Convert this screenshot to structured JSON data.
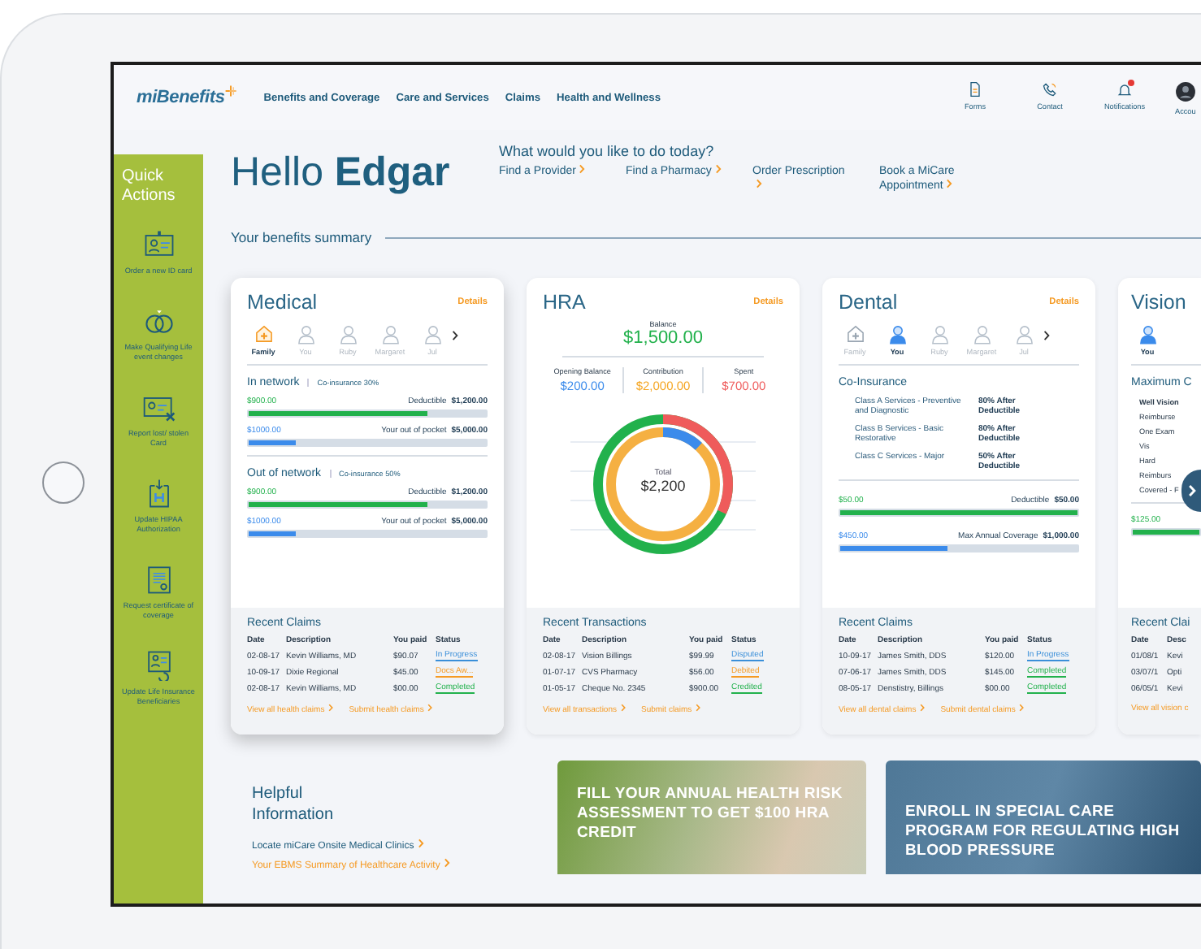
{
  "header": {
    "logo": "miBenefits",
    "nav": [
      "Benefits and Coverage",
      "Care and Services",
      "Claims",
      "Health and Wellness"
    ],
    "utilities": [
      {
        "kind": "forms",
        "label": "Forms"
      },
      {
        "kind": "contact",
        "label": "Contact"
      },
      {
        "kind": "notifications",
        "label": "Notifications",
        "badge": true
      },
      {
        "kind": "account",
        "label": "Accou"
      }
    ]
  },
  "quick_actions": {
    "title": "Quick Actions",
    "items": [
      {
        "kind": "id-card",
        "label": "Order a new ID card"
      },
      {
        "kind": "rings",
        "label": "Make Qualifying Life event changes"
      },
      {
        "kind": "lost-card",
        "label": "Report lost/ stolen Card"
      },
      {
        "kind": "hipaa",
        "label": "Update HIPAA Authorization"
      },
      {
        "kind": "certificate",
        "label": "Request certificate of coverage"
      },
      {
        "kind": "beneficiary",
        "label": "Update Life Insurance Beneficiaries"
      }
    ]
  },
  "greeting": {
    "hello": "Hello",
    "name": "Edgar"
  },
  "tasks": {
    "prompt": "What would you like to do today?",
    "links": [
      "Find a Provider",
      "Find a Pharmacy",
      "Order Prescription",
      "Book a MiCare Appointment"
    ]
  },
  "summary_title": "Your benefits summary",
  "medical": {
    "title": "Medical",
    "details": "Details",
    "members": [
      {
        "kind": "family",
        "label": "Family",
        "selected": true
      },
      {
        "kind": "person",
        "label": "You",
        "selected": false
      },
      {
        "kind": "person",
        "label": "Ruby",
        "selected": false
      },
      {
        "kind": "person",
        "label": "Margaret",
        "selected": false
      },
      {
        "kind": "person",
        "label": "Jul",
        "selected": false
      }
    ],
    "networks": [
      {
        "title": "In network",
        "coinsurance": "Co-insurance 30%",
        "bars": [
          {
            "kind": "deductible",
            "amount": "$900.00",
            "label": "Deductible",
            "total": "$1,200.00",
            "level": 0.75
          },
          {
            "kind": "limit",
            "amount": "$1000.00",
            "label": "Your out of pocket",
            "total": "$5,000.00",
            "level": 0.2
          }
        ]
      },
      {
        "title": "Out of network",
        "coinsurance": "Co-insurance 50%",
        "bars": [
          {
            "kind": "deductible",
            "amount": "$900.00",
            "label": "Deductible",
            "total": "$1,200.00",
            "level": 0.75
          },
          {
            "kind": "limit",
            "amount": "$1000.00",
            "label": "Your out of pocket",
            "total": "$5,000.00",
            "level": 0.2
          }
        ]
      }
    ],
    "claims": {
      "title": "Recent Claims",
      "columns": [
        "Date",
        "Description",
        "You paid",
        "Status"
      ],
      "rows": [
        {
          "date": "02-08-17",
          "description": "Kevin Williams, MD",
          "paid": "$90.07",
          "status": "In Progress",
          "color": "#3a8fd9"
        },
        {
          "date": "10-09-17",
          "description": "Dixie Regional",
          "paid": "$45.00",
          "status": "Docs Aw...",
          "color": "#f59a23"
        },
        {
          "date": "02-08-17",
          "description": "Kevin Williams, MD",
          "paid": "$00.00",
          "status": "Completed",
          "color": "#22b14c"
        }
      ]
    },
    "links": [
      "View all health claims",
      "Submit health claims"
    ]
  },
  "hra": {
    "title": "HRA",
    "details": "Details",
    "balance_label": "Balance",
    "balance": "$1,500.00",
    "stats": [
      {
        "label": "Opening Balance",
        "value": "$200.00",
        "color": "#3b8beb"
      },
      {
        "label": "Contribution",
        "value": "$2,000.00",
        "color": "#f5a623"
      },
      {
        "label": "Spent",
        "value": "$700.00",
        "color": "#ef5b5b"
      }
    ],
    "total_label": "Total",
    "total": "$2,200",
    "claims": {
      "title": "Recent Transactions",
      "columns": [
        "Date",
        "Description",
        "You paid",
        "Status"
      ],
      "rows": [
        {
          "date": "02-08-17",
          "description": "Vision Billings",
          "paid": "$99.99",
          "status": "Disputed",
          "color": "#3a8fd9"
        },
        {
          "date": "01-07-17",
          "description": "CVS Pharmacy",
          "paid": "$56.00",
          "status": "Debited",
          "color": "#f59a23"
        },
        {
          "date": "01-05-17",
          "description": "Cheque No. 2345",
          "paid": "$900.00",
          "status": "Credited",
          "color": "#22b14c"
        }
      ]
    },
    "links": [
      "View all transactions",
      "Submit claims"
    ]
  },
  "dental": {
    "title": "Dental",
    "details": "Details",
    "members": [
      {
        "kind": "family",
        "label": "Family",
        "selected": false
      },
      {
        "kind": "person",
        "label": "You",
        "selected": true
      },
      {
        "kind": "person",
        "label": "Ruby",
        "selected": false
      },
      {
        "kind": "person",
        "label": "Margaret",
        "selected": false
      },
      {
        "kind": "person",
        "label": "Jul",
        "selected": false
      }
    ],
    "coinsurance_title": "Co-Insurance",
    "services": [
      {
        "name": "Class A Services - Preventive and Diagnostic",
        "coverage": "80% After Deductible"
      },
      {
        "name": "Class B Services - Basic Restorative",
        "coverage": "80% After Deductible"
      },
      {
        "name": "Class C Services - Major",
        "coverage": "50% After Deductible"
      }
    ],
    "bars": [
      {
        "kind": "deductible",
        "amount": "$50.00",
        "label": "Deductible",
        "total": "$50.00",
        "level": 1
      },
      {
        "kind": "limit",
        "amount": "$450.00",
        "label": "Max Annual Coverage",
        "total": "$1,000.00",
        "level": 0.45
      }
    ],
    "claims": {
      "title": "Recent Claims",
      "columns": [
        "Date",
        "Description",
        "You paid",
        "Status"
      ],
      "rows": [
        {
          "date": "10-09-17",
          "description": "James Smith, DDS",
          "paid": "$120.00",
          "status": "In Progress",
          "color": "#3a8fd9"
        },
        {
          "date": "07-06-17",
          "description": "James Smith, DDS",
          "paid": "$145.00",
          "status": "Completed",
          "color": "#22b14c"
        },
        {
          "date": "08-05-17",
          "description": "Denstistry, Billings",
          "paid": "$00.00",
          "status": "Completed",
          "color": "#22b14c"
        }
      ]
    },
    "links": [
      "View all dental claims",
      "Submit dental claims"
    ]
  },
  "vision": {
    "title": "Vision",
    "members": [
      {
        "kind": "person",
        "label": "You",
        "selected": true
      }
    ],
    "heading": "Maximum C",
    "lines": [
      "Well Vision",
      "Reimburse",
      "One Exam",
      "Vis",
      "Hard",
      "Reimburs",
      "Covered - F"
    ],
    "bar": {
      "kind": "deductible",
      "amount": "$125.00",
      "level": 1
    },
    "claims": {
      "title": "Recent Clai",
      "columns": [
        "Date",
        "Desc"
      ],
      "rows": [
        [
          "01/08/1",
          "Kevi"
        ],
        [
          "03/07/1",
          "Opti"
        ],
        [
          "06/05/1",
          "Kevi"
        ]
      ]
    },
    "link": "View all vision c"
  },
  "helpful": {
    "title": "Helpful Information",
    "links": [
      {
        "kind": "primary",
        "label": "Locate miCare Onsite Medical Clinics"
      },
      {
        "kind": "accent",
        "label": "Your EBMS Summary of Healthcare Activity"
      }
    ]
  },
  "promos": [
    {
      "kind": "wellness",
      "text": "FILL YOUR ANNUAL HEALTH RISK ASSESSMENT TO GET $100 HRA CREDIT"
    },
    {
      "kind": "care",
      "text": "ENROLL IN SPECIAL CARE PROGRAM FOR REGULATING HIGH BLOOD PRESSURE"
    }
  ]
}
